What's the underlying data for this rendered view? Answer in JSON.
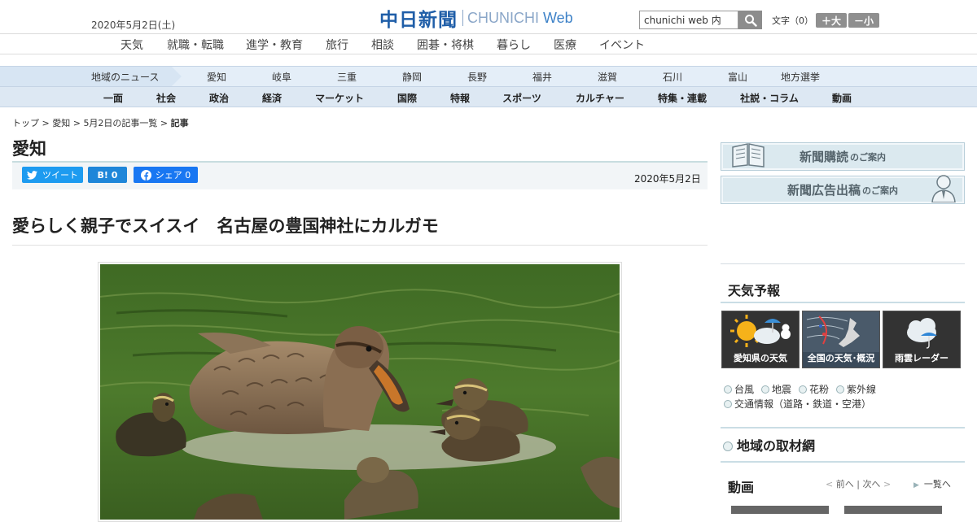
{
  "header": {
    "date": "2020年5月2日(土)",
    "logo_jp": "中日新聞",
    "logo_en1": "CHUNICHI",
    "logo_en2": "Web",
    "search_value": "chunichi web 内",
    "font_size_label": "文字（0）",
    "font_up": "＋大",
    "font_down": "－小"
  },
  "nav_main": [
    "天気",
    "就職・転職",
    "進学・教育",
    "旅行",
    "相談",
    "囲碁・将棋",
    "暮らし",
    "医療",
    "イベント"
  ],
  "nav_region": {
    "label": "地域のニュース",
    "items": [
      "愛知",
      "岐阜",
      "三重",
      "静岡",
      "長野",
      "福井",
      "滋賀",
      "石川",
      "富山",
      "地方選挙"
    ]
  },
  "nav_category": [
    "一面",
    "社会",
    "政治",
    "経済",
    "マーケット",
    "国際",
    "特報",
    "スポーツ",
    "カルチャー",
    "特集・連載",
    "社説・コラム",
    "動画"
  ],
  "breadcrumb": {
    "top": "トップ",
    "sep": " > ",
    "pref": "愛知",
    "list": "5月2日の記事一覧",
    "current": "記事"
  },
  "section_title": "愛知",
  "share": {
    "tweet": "ツイート",
    "hatena": "B! 0",
    "facebook": "シェア 0"
  },
  "article": {
    "date": "2020年5月2日",
    "title": "愛らしく親子でスイスイ　名古屋の豊国神社にカルガモ"
  },
  "sidebar": {
    "banner1_main": "新聞購読",
    "banner1_sub": "のご案内",
    "banner2_main": "新聞広告出稿",
    "banner2_sub": "のご案内",
    "weather_title": "天気予報",
    "weather_tiles": [
      "愛知県の天気",
      "全国の天気･概況",
      "雨雲レーダー"
    ],
    "quick_links": [
      "台風",
      "地震",
      "花粉",
      "紫外線",
      "交通情報（道路・鉄道・空港）"
    ],
    "local_network": "地域の取材網",
    "video_title": "動画",
    "video_prev": "前へ",
    "video_next": "次へ",
    "video_sep": "|",
    "video_list": "一覧へ"
  },
  "colors": {
    "brand_blue": "#1f5ea8",
    "twitter": "#1d9bf0",
    "hatena": "#1e86d9",
    "facebook": "#1877f2",
    "region_nav_bg": "#e4eef8",
    "category_nav_bg": "#dde8f3"
  }
}
